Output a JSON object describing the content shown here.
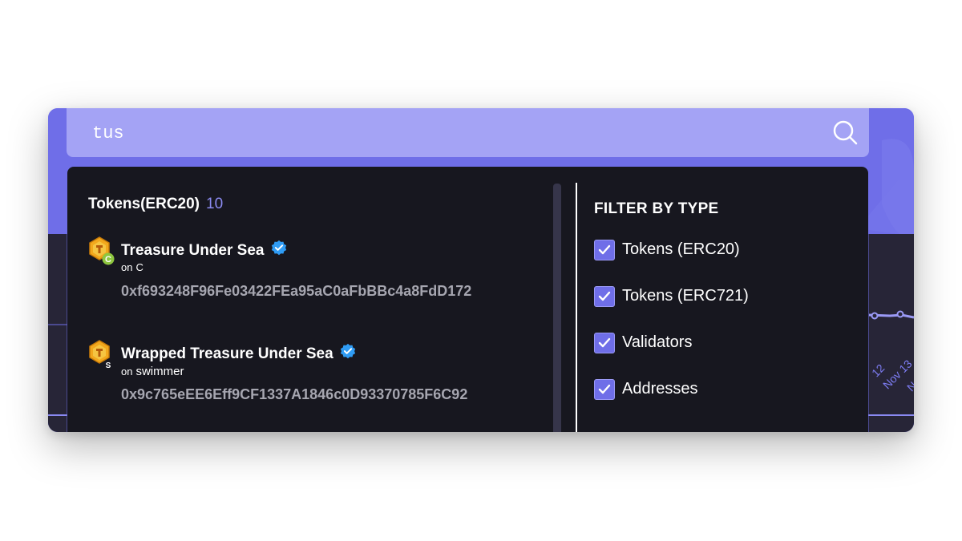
{
  "search": {
    "value": "tus",
    "icon": "search-icon"
  },
  "results": {
    "section_title": "Tokens(ERC20)",
    "section_count": "10",
    "items": [
      {
        "name": "Treasure Under Sea",
        "chain_prefix": "on",
        "chain": "C",
        "badge": "C",
        "address": "0xf693248F96Fe03422FEa95aC0aFbBBc4a8FdD172",
        "verified": true
      },
      {
        "name": "Wrapped Treasure Under Sea",
        "chain_prefix": "on",
        "chain": "swimmer",
        "badge": "S",
        "address": "0x9c765eEE6Eff9CF1337A1846c0D93370785F6C92",
        "verified": true
      }
    ]
  },
  "filters": {
    "title": "FILTER BY TYPE",
    "items": [
      {
        "label": "Tokens (ERC20)",
        "checked": true
      },
      {
        "label": "Tokens (ERC721)",
        "checked": true
      },
      {
        "label": "Validators",
        "checked": true
      },
      {
        "label": "Addresses",
        "checked": true
      }
    ]
  },
  "background_chart": {
    "labels": [
      "12",
      "Nov 13",
      "No"
    ]
  },
  "colors": {
    "accent": "#6f6ee8",
    "search_bar": "#a4a3f5",
    "dropdown_bg": "#17171f",
    "verified": "#2f9cf5",
    "address_text": "#a6a6b0"
  }
}
